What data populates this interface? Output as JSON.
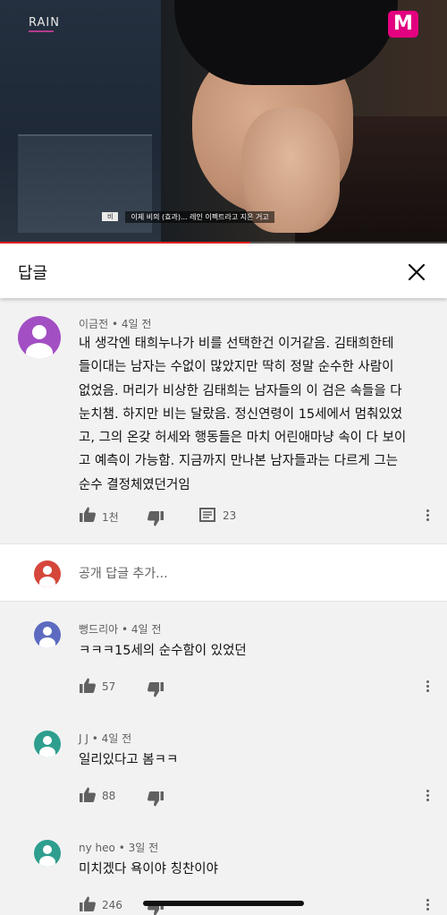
{
  "video": {
    "channel_logo": "RAIN",
    "network_logo": "M",
    "subtitle_tag": "비",
    "subtitle_text": "이제 비의 (효과)... 레인 이펙트라고 지은 거고",
    "progress_fraction": 0.56,
    "accent_color": "#e02020",
    "network_color": "#e3007f"
  },
  "header": {
    "title": "답글",
    "close_icon": "close-icon"
  },
  "main_comment": {
    "author": "이금전",
    "time": "4일 전",
    "avatar_color": "#a24fc4",
    "lines": [
      "내 생각엔 태희누나가 비를 선택한건 이거같음. 김태희한테",
      "들이대는 남자는 수없이 많았지만 딱히 정말 순수한 사람이",
      "없었음. 머리가 비상한 김태희는 남자들의 이 검은 속들을 다",
      "눈치챔. 하지만 비는 달랐음. 정신연령이 15세에서 멈춰있었",
      "고, 그의 온갖 허세와 행동들은 마치 어린애마냥 속이 다 보이",
      "고 예측이 가능함. 지금까지 만나본 남자들과는 다르게 그는",
      "순수 결정체였던거임"
    ],
    "likes": "1천",
    "replies": "23"
  },
  "add_reply": {
    "placeholder": "공개 답글 추가...",
    "avatar_color": "#d5473a"
  },
  "replies": [
    {
      "author": "뻥드리아",
      "time": "4일 전",
      "text": "ㅋㅋㅋ15세의 순수함이 있었던",
      "likes": "57",
      "avatar_color": "#5c6bc0"
    },
    {
      "author": "J J",
      "time": "4일 전",
      "text": "일리있다고 봄ㅋㅋ",
      "likes": "88",
      "avatar_color": "#2e9e8f"
    },
    {
      "author": "ny heo",
      "time": "3일 전",
      "text": "미치겠다 욕이야 칭찬이야",
      "likes": "246",
      "avatar_color": "#2e9e8f"
    }
  ]
}
